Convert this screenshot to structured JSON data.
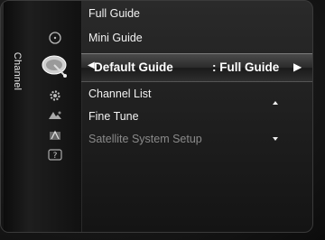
{
  "tab": {
    "label": "Channel"
  },
  "icons": [
    "clock-icon",
    "satellite-dish-icon",
    "gear-icon",
    "input-icon",
    "antenna-icon",
    "help-icon"
  ],
  "menu": {
    "items": [
      {
        "label": "Full Guide",
        "enabled": true
      },
      {
        "label": "Mini Guide",
        "enabled": true
      },
      {
        "label": "Channel List",
        "enabled": true
      },
      {
        "label": "Fine Tune",
        "enabled": true
      },
      {
        "label": "Satellite System Setup",
        "enabled": false
      }
    ],
    "selected": {
      "label": "Default Guide",
      "value": ": Full Guide"
    }
  },
  "colors": {
    "text": "#f2f2f2",
    "disabled": "#8a8a8a",
    "highlight": "#3a3a3a"
  }
}
